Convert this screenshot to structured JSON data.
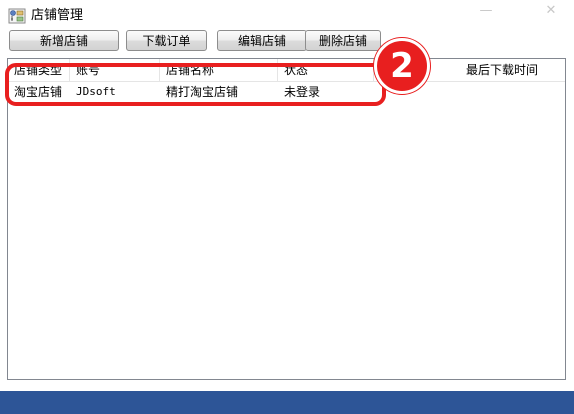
{
  "window": {
    "title": "店铺管理",
    "minimize_glyph": "—",
    "close_glyph": "✕"
  },
  "toolbar": {
    "buttons": [
      {
        "label": "新增店铺"
      },
      {
        "label": "下载订单"
      },
      {
        "label": "编辑店铺"
      },
      {
        "label": "删除店铺"
      }
    ]
  },
  "table": {
    "columns": [
      "店铺类型",
      "账号",
      "店铺名称",
      "状态",
      "最后下载时间"
    ],
    "rows": [
      {
        "shop_type": "淘宝店铺",
        "account": "JDsoft",
        "shop_name": "精打淘宝店铺",
        "status": "未登录",
        "last_download": ""
      }
    ]
  },
  "annotation": {
    "step_number": "2",
    "color": "#e81f1f"
  },
  "colors": {
    "statusbar": "#2d5597",
    "accent": "#e81f1f"
  }
}
